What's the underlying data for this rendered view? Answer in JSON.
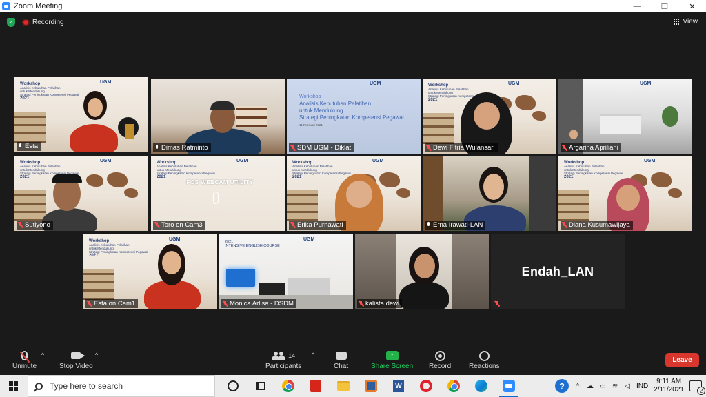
{
  "window": {
    "title": "Zoom Meeting",
    "minimize": "—",
    "maximize": "❐",
    "close": "✕"
  },
  "meeting": {
    "recording_label": "Recording",
    "view_label": "View"
  },
  "tiles": [
    {
      "name": "Esta",
      "mic": "on",
      "active": true,
      "kind": "workshop-esta"
    },
    {
      "name": "Dimas Ratminto",
      "mic": "on",
      "kind": "office"
    },
    {
      "name": "SDM UGM - Diklat",
      "mic": "muted",
      "kind": "slide",
      "slide": {
        "label": "Workshop",
        "line1": "Analisis Kebutuhan Pelatihan",
        "line2": "untuk Mendukung",
        "line3": "Strategi Peningkatan Kompetensi Pegawai",
        "date": "11 Februari 2021"
      }
    },
    {
      "name": "Dewi Fitria Wulansari",
      "mic": "muted",
      "kind": "workshop"
    },
    {
      "name": "Argarina Apriliani",
      "mic": "muted",
      "kind": "kitchen"
    },
    {
      "name": "Sutiyono",
      "mic": "muted",
      "kind": "workshop"
    },
    {
      "name": "Toro on Cam3",
      "mic": "muted",
      "kind": "fos",
      "overlay": "FOS WEBCAM UTILITY"
    },
    {
      "name": "Erika Purnawati",
      "mic": "muted",
      "kind": "workshop"
    },
    {
      "name": "Erna Irawati-LAN",
      "mic": "on",
      "kind": "erna"
    },
    {
      "name": "Diana Kusumawijaya",
      "mic": "muted",
      "kind": "workshop"
    },
    {
      "name": "Esta on Cam1",
      "mic": "muted",
      "kind": "workshop-esta"
    },
    {
      "name": "Monica Arlisa - DSDM",
      "mic": "muted",
      "kind": "english",
      "overlay": "2021\nINTENSIVE ENGLISH COURSE"
    },
    {
      "name": "kalista dewi",
      "mic": "muted",
      "kind": "kalista"
    },
    {
      "name": "Endah_LAN",
      "mic": "muted",
      "kind": "nocam"
    }
  ],
  "workshop_text": {
    "label": "Workshop",
    "line1": "Analisis Kebutuhan Pelatihan",
    "line2": "untuk Mendukung",
    "line3": "Strategi Peningkatan Kompetensi Pegawai",
    "year": "2021",
    "ugm": "UGM"
  },
  "toolbar": {
    "unmute": "Unmute",
    "stop_video": "Stop Video",
    "participants": "Participants",
    "participants_count": "14",
    "chat": "Chat",
    "share_screen": "Share Screen",
    "record": "Record",
    "reactions": "Reactions",
    "leave": "Leave"
  },
  "taskbar": {
    "search_placeholder": "Type here to search",
    "lang": "IND",
    "time": "9:11 AM",
    "date": "2/11/2021",
    "notifications": "2"
  },
  "colors": {
    "active_speaker": "#d4f238",
    "leave": "#d9372d",
    "share": "#23b34a",
    "muted": "#ff4d4d"
  }
}
